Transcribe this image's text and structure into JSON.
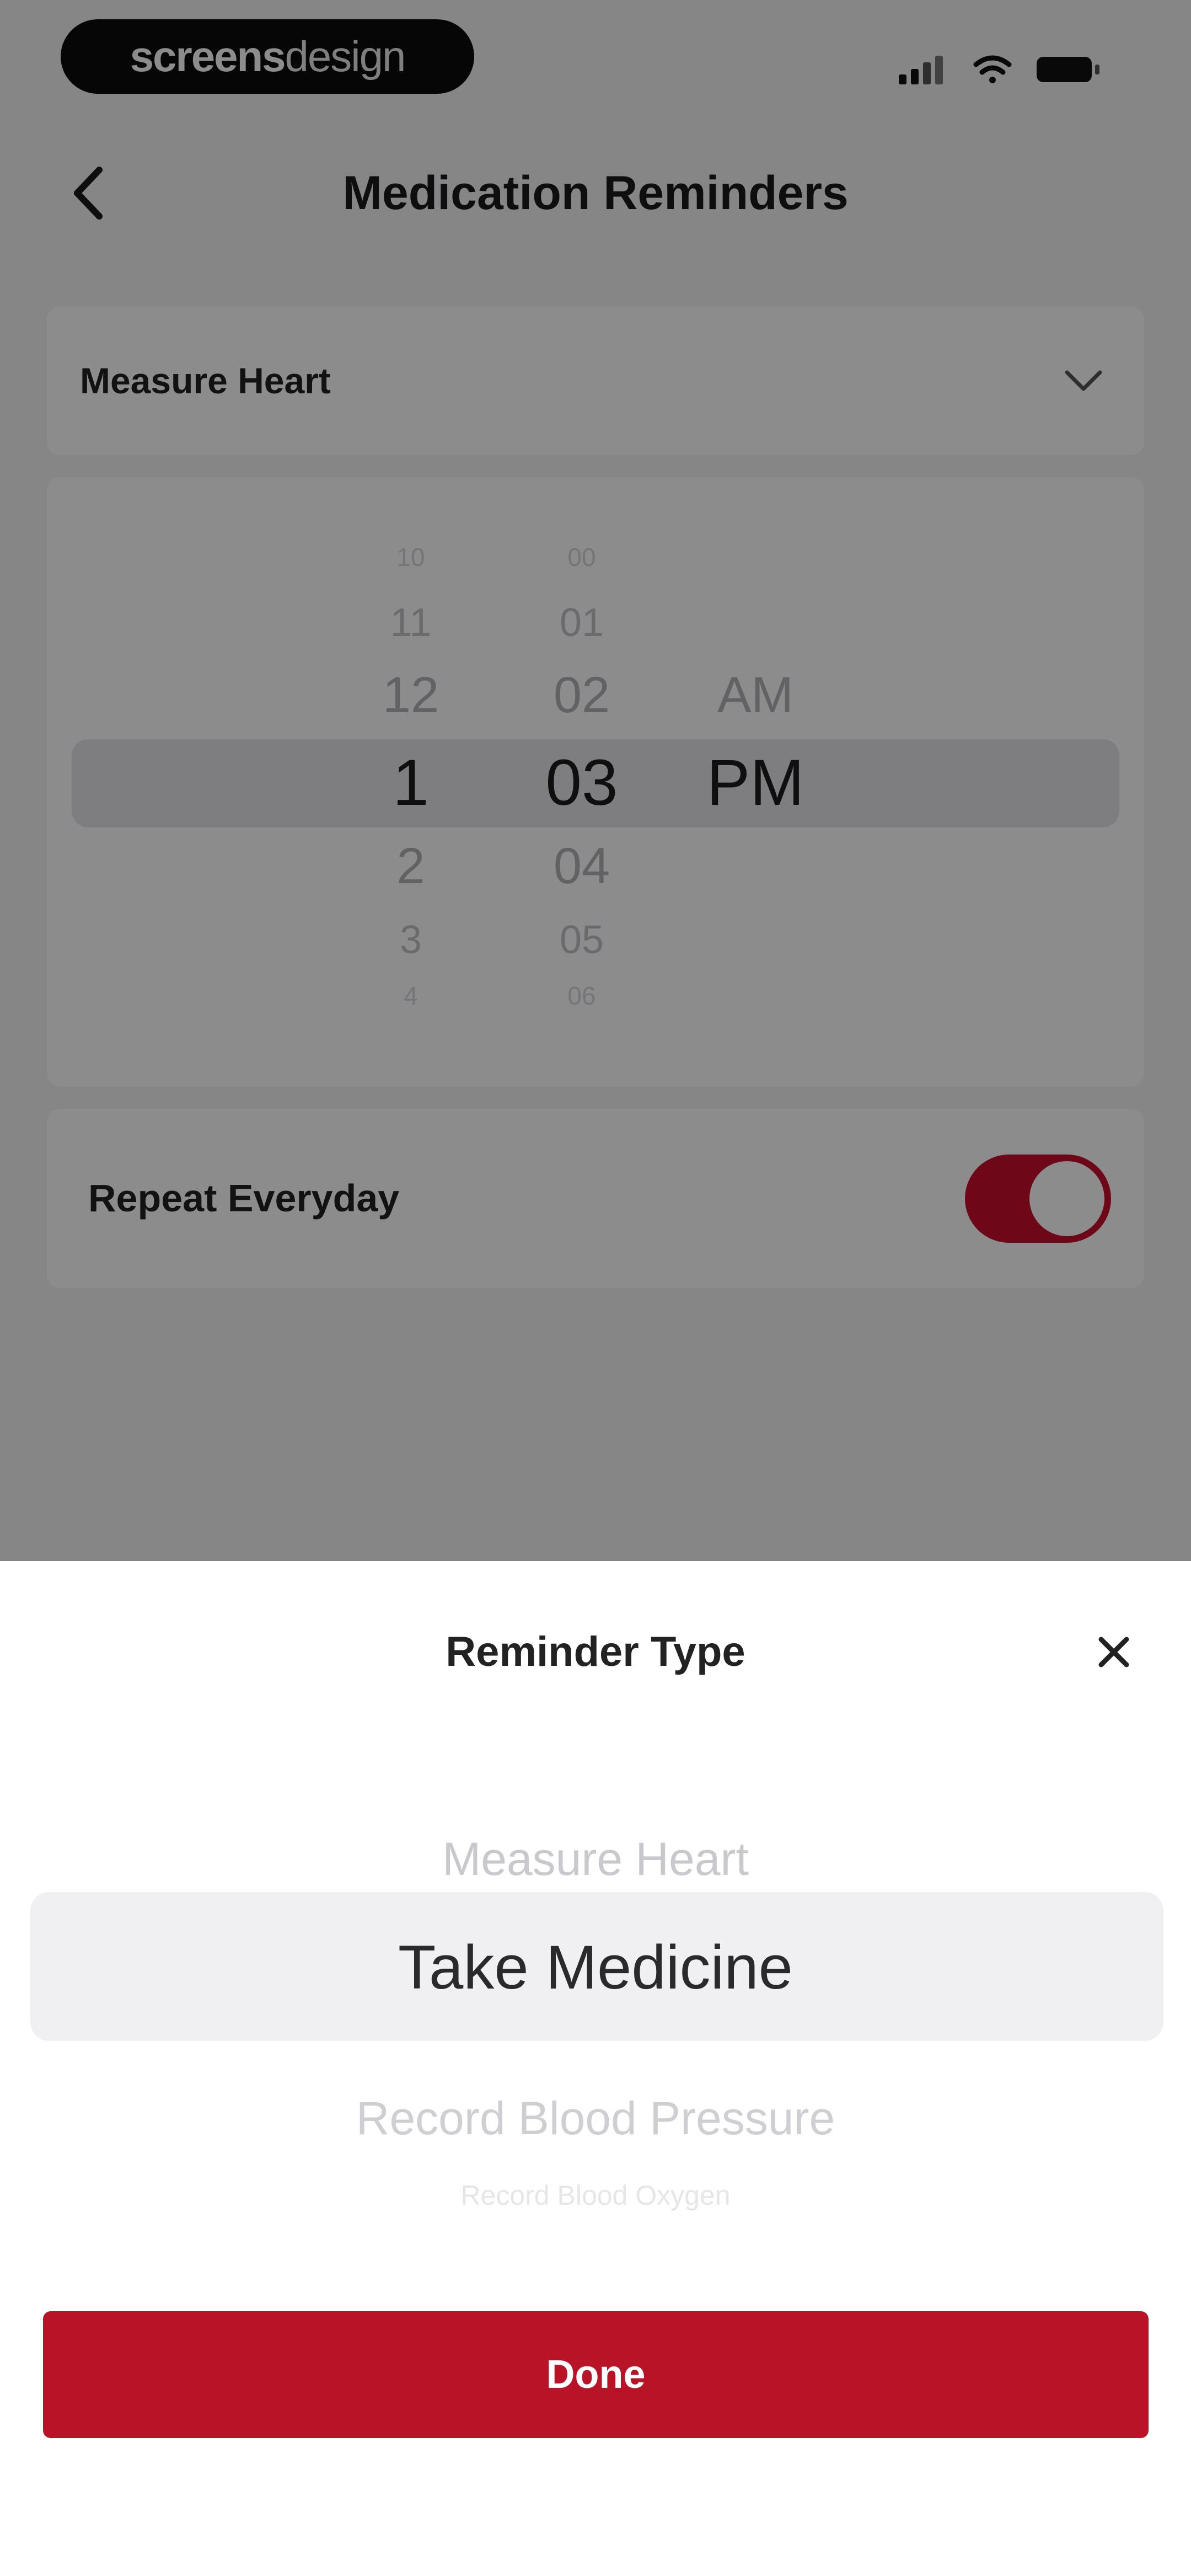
{
  "status_bar": {
    "brand_bold": "screens",
    "brand_thin": "design"
  },
  "nav": {
    "title": "Medication Reminders"
  },
  "reminder_select": {
    "value": "Measure Heart"
  },
  "time_picker": {
    "hours": [
      "10",
      "11",
      "12",
      "1",
      "2",
      "3",
      "4"
    ],
    "minutes": [
      "00",
      "01",
      "02",
      "03",
      "04",
      "05",
      "06"
    ],
    "periods": [
      "AM",
      "PM"
    ],
    "selected": {
      "hour": "1",
      "minute": "03",
      "period": "PM"
    }
  },
  "repeat": {
    "label": "Repeat Everyday",
    "enabled": true
  },
  "sheet": {
    "title": "Reminder Type",
    "options": [
      "Measure Heart",
      "Take Medicine",
      "Record Blood Pressure",
      "Record Blood Oxygen"
    ],
    "selected": "Take Medicine",
    "done_label": "Done"
  },
  "colors": {
    "accent": "#b81326",
    "toggle_on": "#c8102e"
  },
  "icons": {
    "back": "chevron-left-icon",
    "dropdown": "chevron-down-icon",
    "close": "close-icon",
    "signal": "cellular-signal-icon",
    "wifi": "wifi-icon",
    "battery": "battery-icon"
  }
}
